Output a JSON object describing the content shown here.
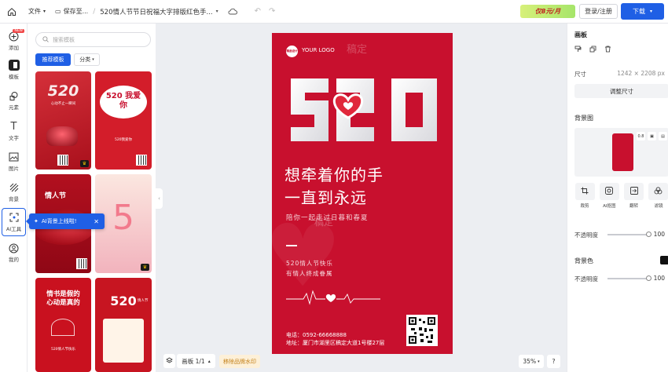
{
  "topbar": {
    "file_menu": "文件",
    "save_status": "保存至...",
    "separator": "/",
    "doc_title": "520情人节节日祝福大字排版红色手...",
    "promo": "仅8元/月",
    "login": "登录/注册",
    "download": "下载"
  },
  "rail": {
    "items": [
      {
        "label": "添加",
        "icon": "plus-circle-icon"
      },
      {
        "label": "模板",
        "icon": "template-icon"
      },
      {
        "label": "元素",
        "icon": "shapes-icon"
      },
      {
        "label": "文字",
        "icon": "text-icon"
      },
      {
        "label": "图片",
        "icon": "image-icon"
      },
      {
        "label": "背景",
        "icon": "background-icon"
      },
      {
        "label": "AI工具",
        "icon": "ai-tool-icon"
      },
      {
        "label": "我的",
        "icon": "user-icon"
      }
    ],
    "new_badge": "NEW"
  },
  "panel": {
    "search_placeholder": "搜索模板",
    "tab_recommended": "推荐模板",
    "tab_category": "分类",
    "thumbs": [
      {
        "title": "520",
        "sub": "心动不止一瞬间",
        "bg": "#c8202c"
      },
      {
        "title": "520 我爱你",
        "sub": "520我爱你",
        "bg": "#d31d2a"
      },
      {
        "title": "情人节",
        "sub": "",
        "bg": "#b0111f"
      },
      {
        "title": "5",
        "sub": "",
        "bg": "#f3c7cc"
      },
      {
        "title": "情书是假的 心动是真的",
        "sub": "520情人节快乐",
        "bg": "#c9111f"
      },
      {
        "title": "520",
        "sub": "情人节",
        "bg": "#c71521"
      }
    ]
  },
  "ai_tip": {
    "text": "AI背景上线啦!",
    "close": "✕"
  },
  "poster": {
    "logo_circle": "精品设计",
    "logo_text": "YOUR LOGO",
    "watermark": "稿定",
    "big_number": "520",
    "headline1": "想牵着你的手",
    "headline2": "一直到永远",
    "subline": "陪你一起走过日暮和春夏",
    "small1": "520情人节快乐",
    "small2": "有情人终成眷属",
    "phone": "电话：0592-66668888",
    "address": "地址：厦门市湖里区稿定大道1号楼27层",
    "colors": {
      "bg": "#c8102e"
    }
  },
  "canvas_bar": {
    "page_count": "画板 1/1",
    "remove_watermark": "移除品牌水印",
    "zoom": "35%",
    "help": "?"
  },
  "rpanel": {
    "section_canvas": "画板",
    "size_label": "尺寸",
    "size_value": "1242 × 2208 px",
    "resize": "调整尺寸",
    "section_bg": "背景图",
    "bg_tools": [
      "0.8",
      "▣",
      "▤"
    ],
    "tools": [
      {
        "label": "裁剪",
        "icon": "crop-icon"
      },
      {
        "label": "AI抠图",
        "icon": "cutout-icon"
      },
      {
        "label": "翻转",
        "icon": "flip-icon"
      },
      {
        "label": "滤镜",
        "icon": "filter-icon"
      }
    ],
    "opacity_label": "不透明度",
    "opacity_value": "100",
    "section_bgcolor": "背景色",
    "opacity2_label": "不透明度",
    "opacity2_value": "100"
  }
}
